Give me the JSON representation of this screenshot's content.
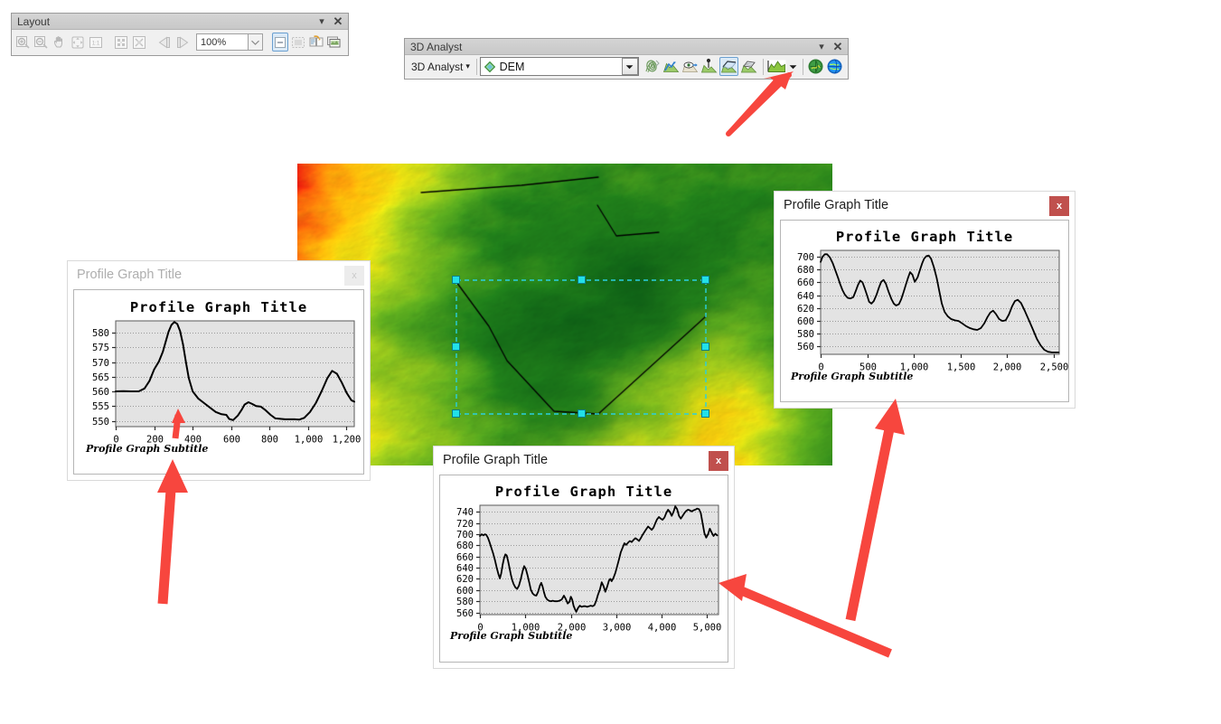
{
  "layout_toolbar": {
    "title": "Layout",
    "title_buttons": [
      {
        "name": "toolbar-options-button",
        "glyph": "▾"
      },
      {
        "name": "toolbar-close-button",
        "glyph": "✕"
      }
    ],
    "buttons": [
      {
        "name": "zoom-in-icon",
        "label": "Zoom In",
        "enabled": false
      },
      {
        "name": "zoom-out-icon",
        "label": "Zoom Out",
        "enabled": false
      },
      {
        "name": "pan-icon",
        "label": "Pan",
        "enabled": false
      },
      {
        "name": "zoom-whole-page-icon",
        "label": "Zoom Whole Page",
        "enabled": false
      },
      {
        "name": "zoom-100-percent-icon",
        "label": "Zoom to 100%",
        "enabled": false
      },
      {
        "name": "fixed-zoom-in-icon",
        "label": "Fixed Zoom In",
        "enabled": false
      },
      {
        "name": "fixed-zoom-out-icon",
        "label": "Fixed Zoom Out",
        "enabled": false
      },
      {
        "name": "go-back-extent-icon",
        "label": "Go Back To Extent",
        "enabled": false
      },
      {
        "name": "go-forward-extent-icon",
        "label": "Go Forward To Extent",
        "enabled": false
      }
    ],
    "zoom_value": "100%",
    "right_buttons": [
      {
        "name": "toggle-draft-mode-icon",
        "label": "Toggle Draft Mode",
        "enabled": true
      },
      {
        "name": "focus-data-frame-icon",
        "label": "Focus Data Frame",
        "enabled": false
      },
      {
        "name": "change-layout-icon",
        "label": "Change Layout",
        "enabled": true
      },
      {
        "name": "data-driven-pages-icon",
        "label": "Data Driven Pages",
        "enabled": true
      }
    ]
  },
  "analyst_toolbar": {
    "title": "3D Analyst",
    "title_buttons": [
      {
        "name": "toolbar-options-button",
        "glyph": "▾"
      },
      {
        "name": "toolbar-close-button",
        "glyph": "✕"
      }
    ],
    "menu_label": "3D Analyst",
    "menu_caret": "▾",
    "layer_value": "DEM",
    "layer_dropdown_caret": "▼",
    "buttons": [
      {
        "name": "contour-icon",
        "label": "Contour",
        "active": false
      },
      {
        "name": "steepest-path-icon",
        "label": "Steepest Path",
        "active": false
      },
      {
        "name": "line-of-sight-icon",
        "label": "Line Of Sight",
        "active": false
      },
      {
        "name": "interpolate-point-icon",
        "label": "Interpolate Point",
        "active": false
      },
      {
        "name": "interpolate-line-icon",
        "label": "Interpolate Line",
        "active": true
      },
      {
        "name": "interpolate-polygon-icon",
        "label": "Interpolate Polygon",
        "active": false
      },
      {
        "name": "create-profile-graph-icon",
        "label": "Create Profile Graph",
        "active": false
      },
      {
        "name": "profile-graph-dropdown-caret",
        "label": "▾",
        "active": false
      },
      {
        "name": "create-steepest-path-icon",
        "label": "Create Steepest Path",
        "active": false
      },
      {
        "name": "arcglobe-icon",
        "label": "ArcGlobe",
        "active": false
      }
    ]
  },
  "map": {
    "name": "dem-raster-map",
    "selection_handles": 6
  },
  "windows": [
    {
      "id": "left",
      "title": "Profile Graph Title",
      "close_label": "x",
      "active": false
    },
    {
      "id": "right",
      "title": "Profile Graph Title",
      "close_label": "x",
      "active": true
    },
    {
      "id": "bottom",
      "title": "Profile Graph Title",
      "close_label": "x",
      "active": true
    }
  ],
  "chart_data": [
    {
      "id": "left",
      "type": "line",
      "title": "Profile Graph Title",
      "subtitle": "Profile Graph Subtitle",
      "xlabel": "",
      "ylabel": "",
      "xlim": [
        0,
        1240
      ],
      "ylim": [
        548,
        584
      ],
      "xticks": [
        0,
        200,
        400,
        600,
        800,
        1000,
        1200
      ],
      "xticklabels": [
        "0",
        "200",
        "400",
        "600",
        "800",
        "1,000",
        "1,200"
      ],
      "yticks": [
        550,
        555,
        560,
        565,
        570,
        575,
        580
      ],
      "yticklabels": [
        "550",
        "555",
        "560",
        "565",
        "570",
        "575",
        "580"
      ],
      "grid": true,
      "legend": false,
      "x": [
        0,
        40,
        80,
        120,
        150,
        175,
        200,
        225,
        245,
        260,
        275,
        290,
        305,
        320,
        335,
        350,
        365,
        380,
        400,
        430,
        460,
        490,
        520,
        550,
        575,
        590,
        610,
        635,
        655,
        670,
        690,
        710,
        730,
        755,
        780,
        805,
        830,
        880,
        930,
        955,
        980,
        1010,
        1040,
        1070,
        1100,
        1125,
        1150,
        1175,
        1200,
        1225,
        1240
      ],
      "y": [
        560.0,
        560.1,
        560.0,
        560.0,
        561.0,
        563.5,
        567.5,
        570.2,
        573.5,
        577.0,
        580.3,
        582.6,
        583.6,
        583.0,
        580.5,
        576.0,
        570.0,
        564.5,
        560.0,
        557.5,
        556.0,
        554.5,
        553.0,
        552.2,
        552.0,
        550.6,
        550.2,
        551.8,
        553.8,
        555.5,
        556.3,
        555.7,
        555.0,
        554.8,
        553.5,
        552.0,
        550.8,
        550.5,
        550.5,
        550.4,
        551.0,
        553.0,
        556.0,
        560.0,
        564.5,
        567.0,
        566.0,
        563.0,
        559.5,
        557.0,
        556.5
      ]
    },
    {
      "id": "right",
      "type": "line",
      "title": "Profile Graph Title",
      "subtitle": "Profile Graph Subtitle",
      "xlabel": "",
      "ylabel": "",
      "xlim": [
        0,
        2560
      ],
      "ylim": [
        548,
        710
      ],
      "xticks": [
        0,
        500,
        1000,
        1500,
        2000,
        2500
      ],
      "xticklabels": [
        "0",
        "500",
        "1,000",
        "1,500",
        "2,000",
        "2,500"
      ],
      "yticks": [
        560,
        580,
        600,
        620,
        640,
        660,
        680,
        700
      ],
      "yticklabels": [
        "560",
        "580",
        "600",
        "620",
        "640",
        "660",
        "680",
        "700"
      ],
      "grid": true,
      "legend": false,
      "x": [
        0,
        20,
        45,
        70,
        100,
        130,
        160,
        185,
        210,
        235,
        260,
        290,
        320,
        350,
        375,
        400,
        425,
        450,
        475,
        500,
        520,
        545,
        570,
        600,
        625,
        650,
        675,
        700,
        730,
        760,
        785,
        810,
        840,
        865,
        890,
        915,
        940,
        960,
        985,
        1010,
        1040,
        1065,
        1090,
        1110,
        1135,
        1160,
        1185,
        1215,
        1245,
        1275,
        1300,
        1330,
        1365,
        1400,
        1440,
        1480,
        1520,
        1560,
        1600,
        1640,
        1680,
        1720,
        1755,
        1790,
        1820,
        1850,
        1880,
        1915,
        1950,
        1985,
        2020,
        2055,
        2085,
        2115,
        2150,
        2190,
        2235,
        2280,
        2320,
        2360,
        2400,
        2440,
        2480,
        2520,
        2555
      ],
      "y": [
        692,
        700,
        704,
        704,
        699,
        690,
        678,
        668,
        657,
        648,
        641,
        636,
        635,
        637,
        646,
        656,
        663,
        660,
        650,
        639,
        630,
        627,
        631,
        641,
        652,
        661,
        664,
        658,
        645,
        634,
        627,
        624,
        626,
        634,
        645,
        657,
        668,
        676,
        672,
        661,
        668,
        679,
        690,
        697,
        701,
        702,
        697,
        684,
        667,
        645,
        627,
        614,
        607,
        603,
        601,
        600,
        596,
        592,
        589,
        587,
        586,
        589,
        596,
        606,
        613,
        616,
        611,
        603,
        600,
        601,
        610,
        623,
        631,
        633,
        628,
        616,
        601,
        586,
        572,
        562,
        555,
        552,
        551,
        551,
        551
      ]
    },
    {
      "id": "bottom",
      "type": "line",
      "title": "Profile Graph Title",
      "subtitle": "Profile Graph Subtitle",
      "xlabel": "",
      "ylabel": "",
      "xlim": [
        0,
        5250
      ],
      "ylim": [
        556,
        752
      ],
      "xticks": [
        0,
        1000,
        2000,
        3000,
        4000,
        5000
      ],
      "xticklabels": [
        "0",
        "1,000",
        "2,000",
        "3,000",
        "4,000",
        "5,000"
      ],
      "yticks": [
        560,
        580,
        600,
        620,
        640,
        660,
        680,
        700,
        720,
        740
      ],
      "yticklabels": [
        "560",
        "580",
        "600",
        "620",
        "640",
        "660",
        "680",
        "700",
        "720",
        "740"
      ],
      "grid": true,
      "legend": false,
      "x": [
        0,
        40,
        80,
        110,
        140,
        175,
        210,
        250,
        290,
        330,
        370,
        410,
        440,
        470,
        500,
        530,
        560,
        590,
        620,
        650,
        680,
        710,
        740,
        780,
        820,
        860,
        900,
        940,
        975,
        1010,
        1050,
        1090,
        1120,
        1160,
        1200,
        1240,
        1280,
        1320,
        1350,
        1380,
        1410,
        1440,
        1480,
        1520,
        1560,
        1600,
        1650,
        1700,
        1750,
        1800,
        1850,
        1890,
        1930,
        1970,
        2000,
        2030,
        2060,
        2090,
        2120,
        2160,
        2200,
        2240,
        2280,
        2320,
        2360,
        2400,
        2440,
        2480,
        2520,
        2560,
        2600,
        2640,
        2680,
        2720,
        2760,
        2800,
        2840,
        2870,
        2900,
        2940,
        2980,
        3020,
        3060,
        3100,
        3140,
        3180,
        3220,
        3260,
        3300,
        3340,
        3380,
        3420,
        3460,
        3500,
        3540,
        3580,
        3620,
        3660,
        3700,
        3740,
        3780,
        3820,
        3860,
        3900,
        3940,
        3980,
        4020,
        4060,
        4100,
        4140,
        4180,
        4220,
        4260,
        4300,
        4340,
        4380,
        4420,
        4460,
        4500,
        4540,
        4580,
        4620,
        4660,
        4700,
        4740,
        4780,
        4820,
        4860,
        4900,
        4940,
        4980,
        5020,
        5060,
        5100,
        5140,
        5180,
        5220
      ],
      "y": [
        697,
        700,
        698,
        700,
        699,
        694,
        686,
        676,
        666,
        654,
        640,
        628,
        621,
        630,
        645,
        657,
        664,
        662,
        652,
        640,
        628,
        618,
        611,
        605,
        602,
        608,
        620,
        634,
        643,
        638,
        626,
        612,
        601,
        594,
        591,
        590,
        597,
        608,
        613,
        606,
        596,
        588,
        583,
        581,
        580,
        581,
        580,
        580,
        581,
        583,
        590,
        584,
        576,
        579,
        588,
        583,
        572,
        566,
        561,
        568,
        572,
        570,
        571,
        571,
        570,
        571,
        572,
        571,
        573,
        581,
        592,
        601,
        614,
        607,
        597,
        606,
        617,
        620,
        616,
        622,
        631,
        643,
        655,
        668,
        676,
        684,
        681,
        685,
        688,
        686,
        690,
        693,
        691,
        688,
        693,
        699,
        704,
        709,
        714,
        711,
        708,
        712,
        720,
        727,
        731,
        728,
        726,
        730,
        738,
        744,
        740,
        733,
        740,
        750,
        745,
        733,
        728,
        733,
        738,
        742,
        744,
        743,
        741,
        743,
        744,
        746,
        745,
        738,
        720,
        702,
        694,
        700,
        710,
        703,
        697,
        701,
        698,
        694
      ]
    }
  ],
  "annotation_arrows": [
    {
      "name": "arrow-to-profile-graph-tool",
      "color": "#f7463e"
    },
    {
      "name": "arrow-to-left-graph-small",
      "color": "#f7463e"
    },
    {
      "name": "arrow-to-left-graph-large",
      "color": "#f7463e"
    },
    {
      "name": "arrow-to-right-graph",
      "color": "#f7463e"
    },
    {
      "name": "arrow-to-bottom-graph",
      "color": "#f7463e"
    }
  ]
}
